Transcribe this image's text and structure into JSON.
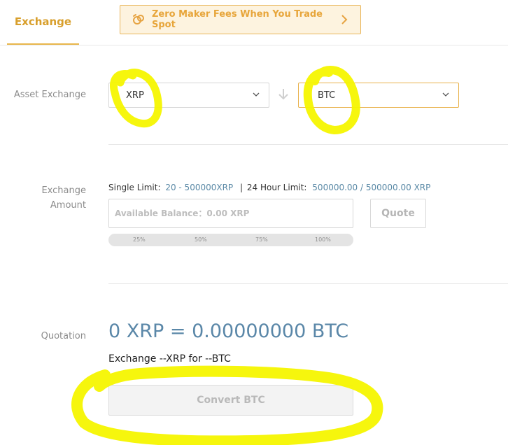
{
  "header": {
    "tab_exchange": "Exchange",
    "promo_text": "Zero Maker Fees When You Trade Spot",
    "promo_icon": "loop-icon",
    "promo_chevron": "chevron-right-icon"
  },
  "asset_exchange": {
    "label": "Asset Exchange",
    "from_value": "XRP",
    "to_value": "BTC",
    "swap_icon": "arrow-down-icon"
  },
  "exchange_amount": {
    "label_line1": "Exchange",
    "label_line2": "Amount",
    "single_limit_label": "Single Limit:",
    "single_limit_value": "20 - 500000XRP",
    "separator": "|",
    "hour_limit_label": "24 Hour Limit:",
    "hour_limit_value": "500000.00 / 500000.00 XRP",
    "input_placeholder": "Available Balance：0.00 XRP",
    "quote_button": "Quote",
    "percentages": [
      "25%",
      "50%",
      "75%",
      "100%"
    ]
  },
  "quotation": {
    "label": "Quotation",
    "value": "0 XRP = 0.00000000 BTC",
    "subtitle": "Exchange --XRP for --BTC",
    "convert_button": "Convert BTC"
  },
  "colors": {
    "accent": "#e8b64a",
    "link_blue": "#5a87a8",
    "highlighter": "#f5f500"
  }
}
